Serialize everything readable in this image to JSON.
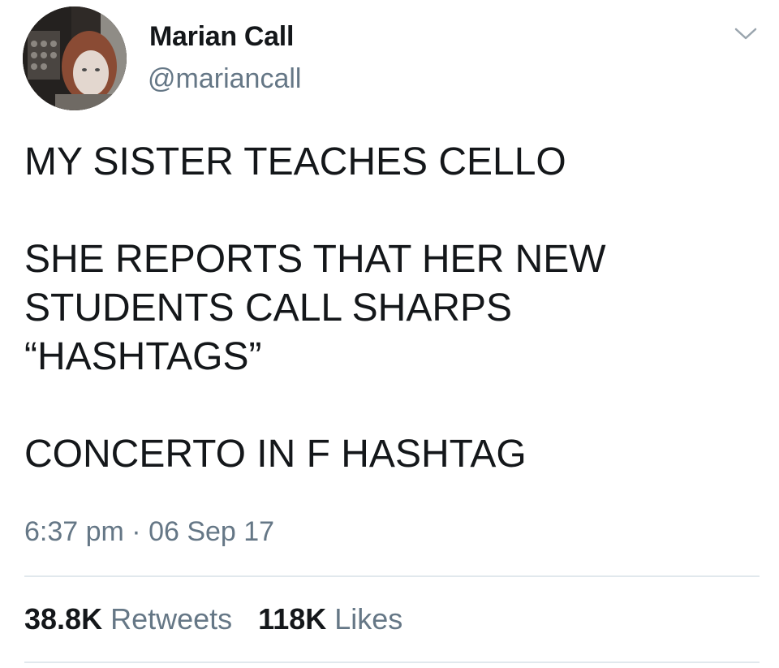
{
  "author": {
    "display_name": "Marian Call",
    "handle": "@mariancall"
  },
  "tweet": {
    "paragraphs": [
      "MY SISTER TEACHES CELLO",
      "SHE REPORTS THAT HER NEW\nSTUDENTS CALL SHARPS\n“HASHTAGS”",
      "CONCERTO IN F HASHTAG"
    ],
    "timestamp": "6:37 pm · 06 Sep 17"
  },
  "stats": {
    "retweets_count": "38.8K",
    "retweets_label": "Retweets",
    "likes_count": "118K",
    "likes_label": "Likes"
  },
  "icons": {
    "menu": "chevron-down-icon"
  },
  "colors": {
    "primary_text": "#14171a",
    "secondary_text": "#657786",
    "divider": "#e1e8ed"
  }
}
